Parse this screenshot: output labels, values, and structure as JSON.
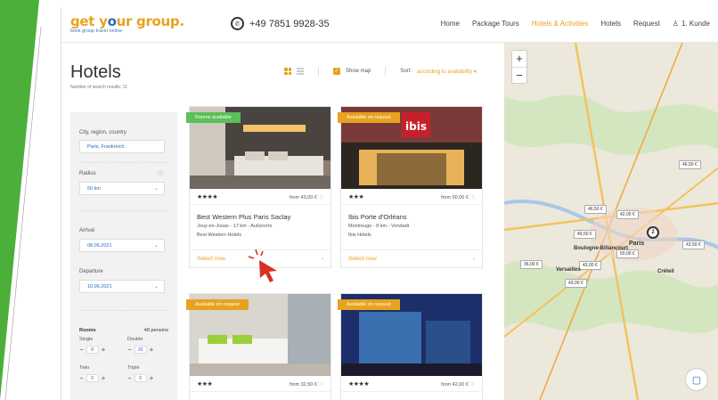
{
  "header": {
    "logo_main_a": "get y",
    "logo_main_b": "ur group.",
    "logo_sub": "book group travel online",
    "phone": "+49 7851 9928-35",
    "nav": [
      "Home",
      "Package Tours",
      "Hotels & Activities",
      "Hotels",
      "Request"
    ],
    "user": "1. Kunde"
  },
  "page": {
    "title": "Hotels",
    "subtitle": "Number of search results: 11",
    "show_map_label": "Show map",
    "sort_label": "Sort:",
    "sort_value": "according to availability"
  },
  "filter": {
    "city_label": "City, region, country",
    "city_value": "Paris, Frankreich",
    "radius_label": "Radius",
    "radius_value": "50 km",
    "arrival_label": "Arrival",
    "arrival_value": "08.06.2021",
    "departure_label": "Departure",
    "departure_value": "10.06.2021",
    "rooms_label": "Rooms",
    "persons_label": "48 persons",
    "single_label": "Single",
    "single_value": "8",
    "double_label": "Double",
    "double_value": "20",
    "twin_label": "Twin",
    "twin_value": "0",
    "triple_label": "Triple",
    "triple_value": "0"
  },
  "hotels": [
    {
      "badge": "Rooms available",
      "stars": "★★★★",
      "price": "from 43,00 €",
      "name": "Best Western Plus Paris Saclay",
      "location": "Jouy-en-Josas - 17 km - Außerorts",
      "chain": "Best Western Hotels",
      "select": "Select now",
      "badge_color": "#5bbf5a"
    },
    {
      "badge": "Available on request",
      "stars": "★★★",
      "price": "from 50,00 €",
      "name": "Ibis Porte d'Orléans",
      "location": "Montrouge - 8 km - Vorstadt",
      "chain": "Ibis Hotels",
      "select": "Select now",
      "badge_color": "#e8a21e"
    },
    {
      "badge": "Available on request",
      "stars": "★★★",
      "price": "from 32,50 €"
    },
    {
      "badge": "Available on request",
      "stars": "★★★★",
      "price": "from 42,00 €"
    }
  ],
  "map": {
    "pins": [
      "46,50 €",
      "46,50 €",
      "42,00 €",
      "49,50 €",
      "43,50 €",
      "50,00 €",
      "36,00 €",
      "43,00 €",
      "43,00 €"
    ],
    "cluster": "2",
    "labels": [
      "Paris",
      "Versailles",
      "Boulogne-Billancourt",
      "Créteil"
    ]
  }
}
